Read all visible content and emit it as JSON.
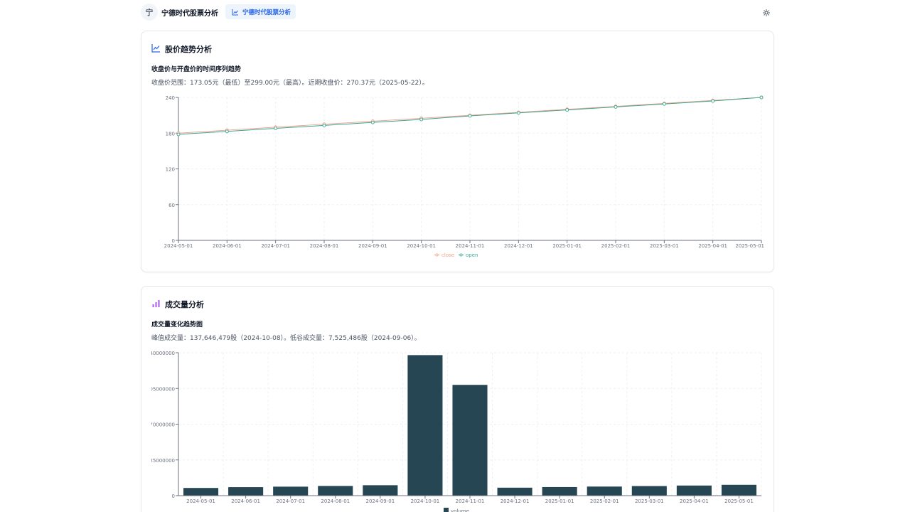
{
  "header": {
    "logo_char": "宁",
    "app_name": "宁德时代股票分析",
    "active_tab": "宁德时代股票分析",
    "tab_icon": "line-chart-icon",
    "theme_icon": "sun-icon"
  },
  "colors": {
    "accent": "#2563eb",
    "close_line": "#f4a08a",
    "open_line": "#3aa892",
    "volume_bar": "#264653",
    "volume_icon": "#a855f7"
  },
  "trend_card": {
    "title": "股价趋势分析",
    "icon": "trend-icon",
    "subtitle": "收盘价与开盘价的时间序列趋势",
    "description": "收盘价范围：173.05元（最低）至299.00元（最高）。近期收盘价：270.37元（2025-05-22）。"
  },
  "volume_card": {
    "title": "成交量分析",
    "icon": "bar-chart-icon",
    "subtitle": "成交量变化趋势图",
    "description": "峰值成交量：137,646,479股（2024-10-08）。低谷成交量：7,525,486股（2024-09-06）。"
  },
  "chart_data": [
    {
      "type": "line",
      "x": [
        "2024-05-01",
        "2024-06-01",
        "2024-07-01",
        "2024-08-01",
        "2024-09-01",
        "2024-10-01",
        "2024-11-01",
        "2024-12-01",
        "2025-01-01",
        "2025-02-01",
        "2025-03-01",
        "2025-04-01",
        "2025-05-01"
      ],
      "xticks": [
        "2024-05-01",
        "2024-06-01",
        "2024-07-01",
        "2024-08-01",
        "2024-09-01",
        "2024-10-01",
        "2024-11-01",
        "2024-12-01",
        "2025-01-01",
        "2025-02-01",
        "2025-03-01",
        "2025-04-01",
        "2025-05-01"
      ],
      "yticks": [
        0,
        60,
        120,
        180,
        240
      ],
      "ylim": [
        0,
        240
      ],
      "series": [
        {
          "name": "close",
          "color": "#f4a08a",
          "values": [
            180,
            185,
            190,
            195,
            200,
            205,
            210,
            215,
            220,
            225,
            230,
            235,
            240
          ]
        },
        {
          "name": "open",
          "color": "#3aa892",
          "values": [
            178,
            183,
            188,
            193,
            198,
            203,
            209,
            214,
            219,
            224,
            229,
            234,
            240
          ]
        }
      ],
      "grid": true,
      "legend": "bottom-center"
    },
    {
      "type": "bar",
      "categories": [
        "2024-05-01",
        "2024-06-01",
        "2024-07-01",
        "2024-08-01",
        "2024-09-01",
        "2024-10-01",
        "2024-11-01",
        "2024-12-01",
        "2025-01-01",
        "2025-02-01",
        "2025-03-01",
        "2025-04-01",
        "2025-05-01"
      ],
      "yticks": [
        0,
        35000000,
        70000000,
        105000000,
        140000000
      ],
      "ytick_labels": [
        "0",
        "35000000",
        "70000000",
        "105000000",
        "140000000"
      ],
      "ylim": [
        0,
        140000000
      ],
      "series": [
        {
          "name": "volume",
          "color": "#264653",
          "values": [
            7525486,
            8300000,
            8800000,
            9500000,
            10200000,
            137646479,
            108500000,
            7800000,
            8400000,
            8900000,
            9400000,
            9900000,
            10600000
          ]
        }
      ],
      "grid": true,
      "legend": "bottom-center"
    }
  ]
}
